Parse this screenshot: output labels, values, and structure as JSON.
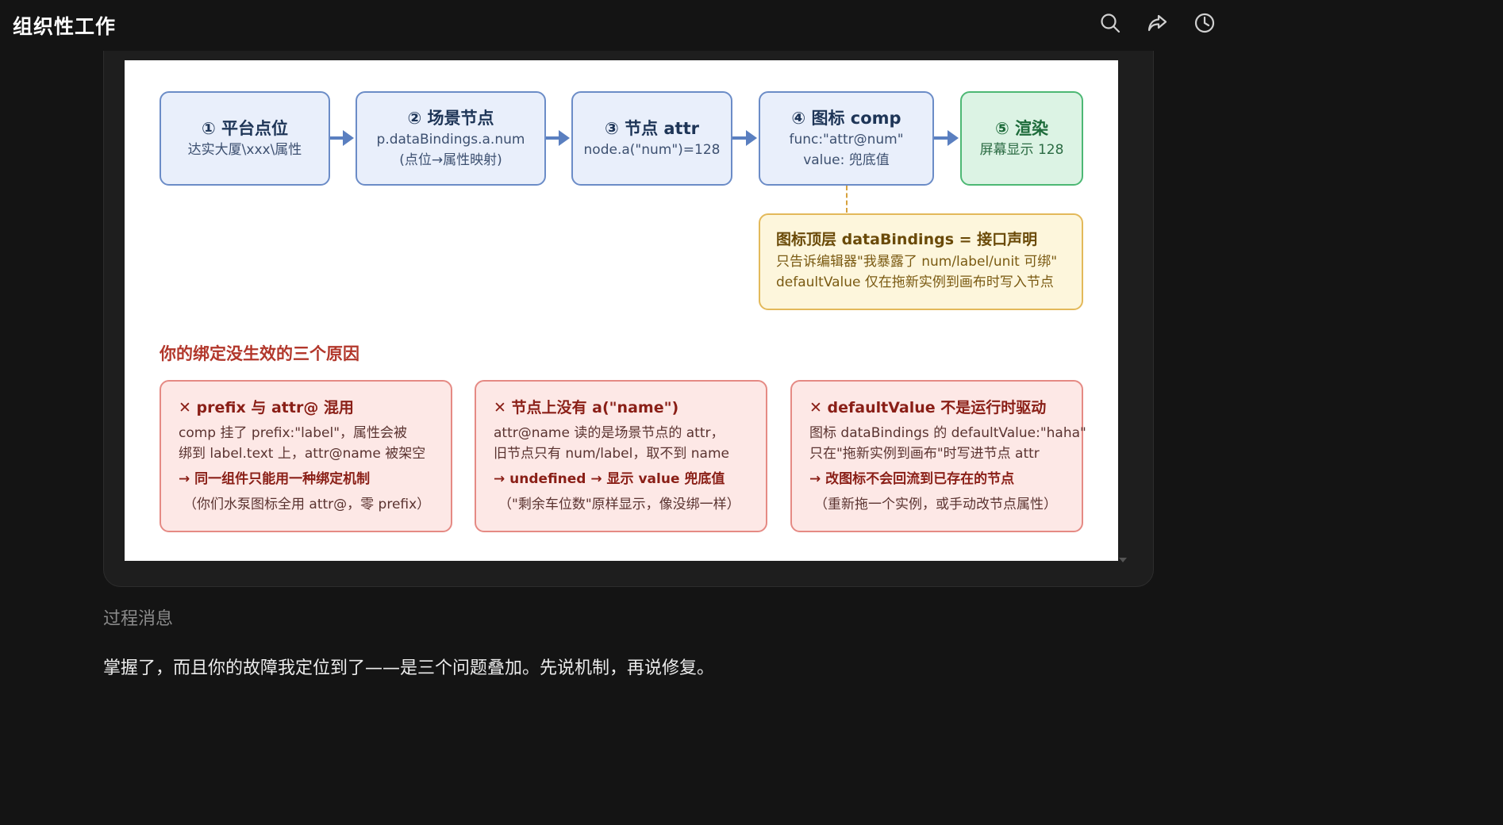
{
  "app": {
    "title": "组织性工作"
  },
  "toolbar": {
    "icons": [
      "search-icon",
      "share-icon",
      "history-icon"
    ]
  },
  "flow": {
    "steps": [
      {
        "title": "① 平台点位",
        "lines": [
          "达实大厦\\xxx\\属性"
        ]
      },
      {
        "title": "② 场景节点",
        "lines": [
          "p.dataBindings.a.num",
          "(点位→属性映射)"
        ]
      },
      {
        "title": "③ 节点 attr",
        "lines": [
          "node.a(\"num\")=128"
        ]
      },
      {
        "title": "④ 图标 comp",
        "lines": [
          "func:\"attr@num\"",
          "value: 兜底值"
        ]
      },
      {
        "title": "⑤ 渲染",
        "lines": [
          "屏幕显示 128"
        ]
      }
    ],
    "note": {
      "title": "图标顶层 dataBindings = 接口声明",
      "lines": [
        "只告诉编辑器\"我暴露了 num/label/unit 可绑\"",
        "defaultValue 仅在拖新实例到画布时写入节点"
      ]
    }
  },
  "reasons": {
    "title": "你的绑定没生效的三个原因",
    "items": [
      {
        "title": "✕ prefix 与 attr@ 混用",
        "line1": "comp 挂了 prefix:\"label\"，属性会被",
        "line2": "绑到 label.text 上，attr@name 被架空",
        "key": "→ 同一组件只能用一种绑定机制",
        "note": "（你们水泵图标全用 attr@，零 prefix）"
      },
      {
        "title": "✕ 节点上没有 a(\"name\")",
        "line1": "attr@name 读的是场景节点的 attr，",
        "line2": "旧节点只有 num/label，取不到 name",
        "key": "→ undefined → 显示 value 兜底值",
        "note": "（\"剩余车位数\"原样显示，像没绑一样）"
      },
      {
        "title": "✕ defaultValue 不是运行时驱动",
        "line1": "图标 dataBindings 的 defaultValue:\"haha\"",
        "line2": "只在\"拖新实例到画布\"时写进节点 attr",
        "key": "→ 改图标不会回流到已存在的节点",
        "note": "（重新拖一个实例，或手动改节点属性）"
      }
    ]
  },
  "process": {
    "label": "过程消息"
  },
  "message": {
    "text": "掌握了，而且你的故障我定位到了——是三个问题叠加。先说机制，再说修复。"
  },
  "colors": {
    "background": "#141414",
    "flow_border": "#6b8cc7",
    "render_border": "#4db874",
    "note_border": "#e3b95a",
    "reason_border": "#e58a84",
    "reason_title": "#b2372b"
  }
}
